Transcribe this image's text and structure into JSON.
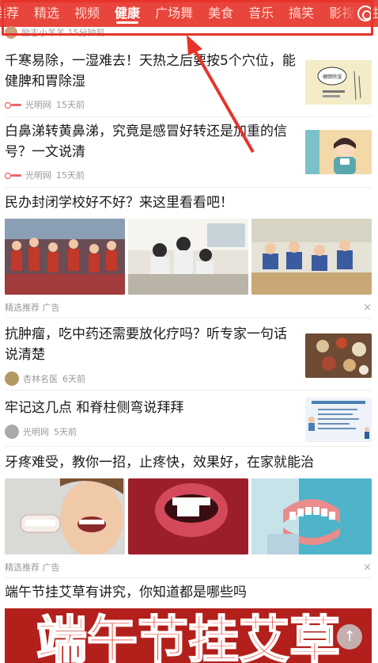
{
  "tabs": [
    {
      "label": "推荐"
    },
    {
      "label": "精选"
    },
    {
      "label": "视频"
    },
    {
      "label": "健康",
      "active": true
    },
    {
      "label": "广场舞"
    },
    {
      "label": "美食"
    },
    {
      "label": "音乐"
    },
    {
      "label": "搞笑"
    },
    {
      "label": "影视"
    },
    {
      "label": "生"
    }
  ],
  "peek": {
    "author": "励志小羊羊",
    "time": "15分钟前"
  },
  "articles": [
    {
      "title": "千寒易除，一湿难去！天热之后要按5个穴位，能健脾和胃除湿",
      "source": "光明网",
      "time": "15天前"
    },
    {
      "title": "白鼻涕转黄鼻涕，究竟是感冒好转还是加重的信号？一文说清",
      "source": "光明网",
      "time": "15天前"
    },
    {
      "title": "民办封闭学校好不好？来这里看看吧！",
      "tag": "精选推荐",
      "ad": "广告"
    },
    {
      "title": "抗肿瘤，吃中药还需要放化疗吗？听专家一句话说清楚",
      "source": "杏林名医",
      "time": "6天前"
    },
    {
      "title": "牢记这几点 和脊柱侧弯说拜拜",
      "source": "光明网",
      "time": "5天前"
    },
    {
      "title": "牙疼难受，教你一招，止疼快，效果好，在家就能治",
      "tag": "精选推荐",
      "ad": "广告"
    },
    {
      "title": "端午节挂艾草有讲究，你知道都是哪些吗"
    }
  ],
  "thumb_texts": {
    "a1": "健脾除湿",
    "banner": "端午节挂艾草"
  },
  "close_glyph": "×",
  "scroll_top_glyph": "↑",
  "colors": {
    "accent": "#e8453c",
    "highlight": "#e8332a"
  }
}
